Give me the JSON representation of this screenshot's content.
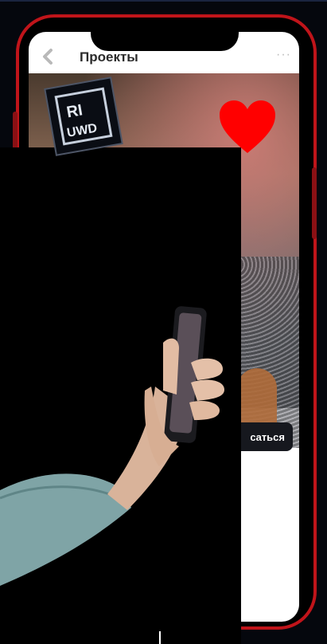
{
  "app": {
    "title": "Проекты",
    "back_icon": "chevron-left-icon",
    "more_icon": "more-dots-icon",
    "more_glyph": "···"
  },
  "main": {
    "contact_button_label": "сaться",
    "photo_description_icon": "project-photo"
  },
  "overlays": {
    "logo_text_top": "RI",
    "logo_text_bottom": "UWD",
    "heart_icon": "heart-icon",
    "hand_image": "hand-holding-phone"
  },
  "colors": {
    "frame": "#c0141a",
    "heart": "#ff0000",
    "button_bg": "#16181e"
  }
}
